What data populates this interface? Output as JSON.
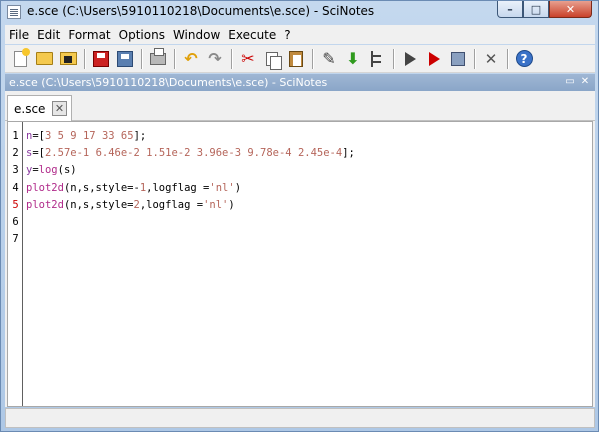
{
  "window": {
    "title": "e.sce (C:\\Users\\5910110218\\Documents\\e.sce) - SciNotes",
    "controls": {
      "minimize": "–",
      "maximize": "□",
      "close": "✕"
    }
  },
  "menu": [
    "File",
    "Edit",
    "Format",
    "Options",
    "Window",
    "Execute",
    "?"
  ],
  "toolbar": {
    "icons": [
      "new-file-icon",
      "open-file-icon",
      "open-file-modified-icon",
      "save-icon",
      "save-as-icon",
      "print-icon",
      "undo-icon",
      "redo-icon",
      "cut-icon",
      "copy-icon",
      "paste-icon",
      "execute-icon",
      "execute-down-icon",
      "tree-icon",
      "run-icon",
      "run-line-icon",
      "run-block-icon",
      "tools-icon",
      "help-icon"
    ]
  },
  "document_strip": {
    "path": "e.sce (C:\\Users\\5910110218\\Documents\\e.sce) - SciNotes",
    "buttons": [
      "▭",
      "✕"
    ]
  },
  "tab": {
    "label": "e.sce",
    "close": "✕"
  },
  "editor": {
    "line_numbers": [
      "1",
      "2",
      "3",
      "4",
      "5",
      "6",
      "7"
    ],
    "error_line": "5",
    "lines": [
      "n=[3 5 9 17 33 65];",
      "s=[2.57e-1 6.46e-2 1.51e-2 3.96e-3 9.78e-4 2.45e-4];",
      "y=log(s)",
      "plot2d(n,s,style=-1,logflag ='nl')",
      "plot2d(n,s,style=2,logflag ='nl')",
      "",
      ""
    ]
  },
  "status": {
    "text": ""
  }
}
